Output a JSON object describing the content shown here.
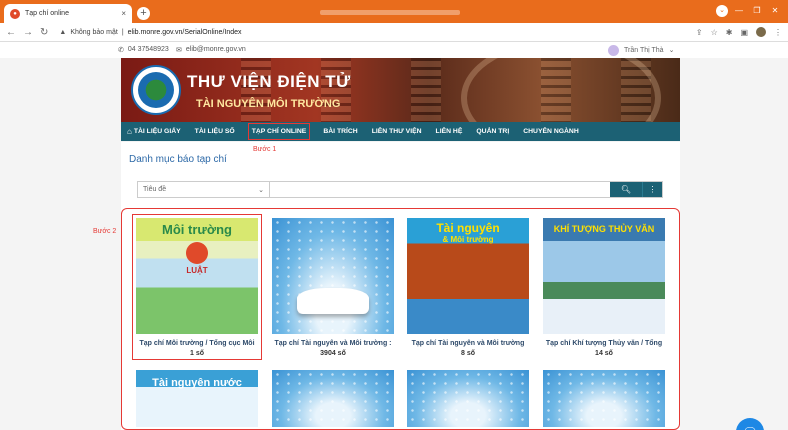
{
  "browser": {
    "tab_title": "Tạp chí online",
    "new_tab": "+",
    "close": "×",
    "url_warning": "Không bảo mật",
    "url_sep": "|",
    "url": "elib.monre.gov.vn/SerialOnline/Index"
  },
  "topinfo": {
    "phone": "04 37548923",
    "email": "elib@monre.gov.vn",
    "user": "Trần Thị Thà"
  },
  "banner": {
    "title": "THƯ VIỆN ĐIỆN TỬ",
    "subtitle": "TÀI NGUYÊN MÔI TRƯỜNG"
  },
  "menu": [
    {
      "label": "TÀI LIỆU GIẤY"
    },
    {
      "label": "TÀI LIỆU SỐ"
    },
    {
      "label": "TẠP CHÍ ONLINE"
    },
    {
      "label": "BÀI TRÍCH"
    },
    {
      "label": "LIÊN THƯ VIỆN"
    },
    {
      "label": "LIÊN HỆ"
    },
    {
      "label": "QUẢN TRỊ"
    },
    {
      "label": "CHUYÊN NGÀNH"
    }
  ],
  "annotations": {
    "step1": "Bước 1",
    "step2": "Bước 2"
  },
  "main": {
    "heading": "Danh mục báo tạp chí",
    "select_value": "Tiêu đề",
    "search_placeholder": ""
  },
  "cards": [
    {
      "caption": "Tạp chí Môi trường / Tổng cục Môi",
      "count": "1 số",
      "cover_title": "Môi trường",
      "cover_sub": "LUẬT"
    },
    {
      "caption": "Tạp chí Tài nguyên và Môi trường :",
      "count": "3904 số"
    },
    {
      "caption": "Tạp chí Tài nguyên và Môi trường",
      "count": "8 số",
      "cover_title": "Tài nguyên",
      "cover_sub": "& Môi trường"
    },
    {
      "caption": "Tạp chí Khí tượng Thủy văn / Tổng",
      "count": "14 số",
      "cover_title": "KHÍ TƯỢNG THỦY VĂN"
    },
    {
      "cover_title": "Tài nguyên nước"
    }
  ]
}
